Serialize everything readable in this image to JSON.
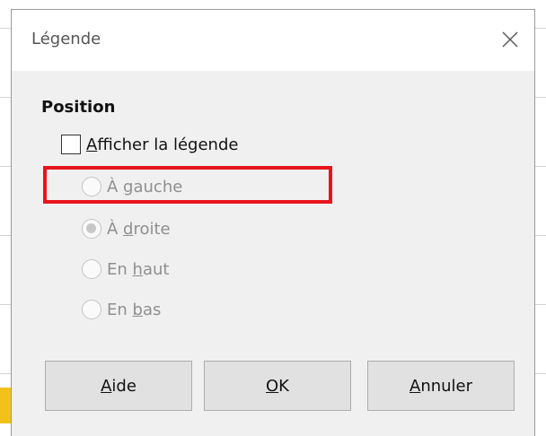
{
  "dialog": {
    "title": "Légende"
  },
  "position": {
    "heading": "Position",
    "show_legend": {
      "mnemonic": "A",
      "rest": "fficher la légende",
      "checked": false
    },
    "options": [
      {
        "pre": "À ",
        "mnemonic": "g",
        "rest": "auche",
        "selected": false,
        "enabled": false
      },
      {
        "pre": "À ",
        "mnemonic": "d",
        "rest": "roite",
        "selected": true,
        "enabled": false
      },
      {
        "pre": "En ",
        "mnemonic": "h",
        "rest": "aut",
        "selected": false,
        "enabled": false
      },
      {
        "pre": "En ",
        "mnemonic": "b",
        "rest": "as",
        "selected": false,
        "enabled": false
      }
    ]
  },
  "buttons": {
    "help": {
      "mnemonic": "A",
      "rest": "ide"
    },
    "ok": {
      "mnemonic": "O",
      "rest": "K"
    },
    "cancel": {
      "mnemonic": "A",
      "rest": "nnuler"
    }
  },
  "colors": {
    "highlight": "#e8141c",
    "dialog_bg": "#f0f0f0",
    "disabled_text": "#8f8f8f"
  },
  "icons": {
    "close": "close-icon"
  }
}
